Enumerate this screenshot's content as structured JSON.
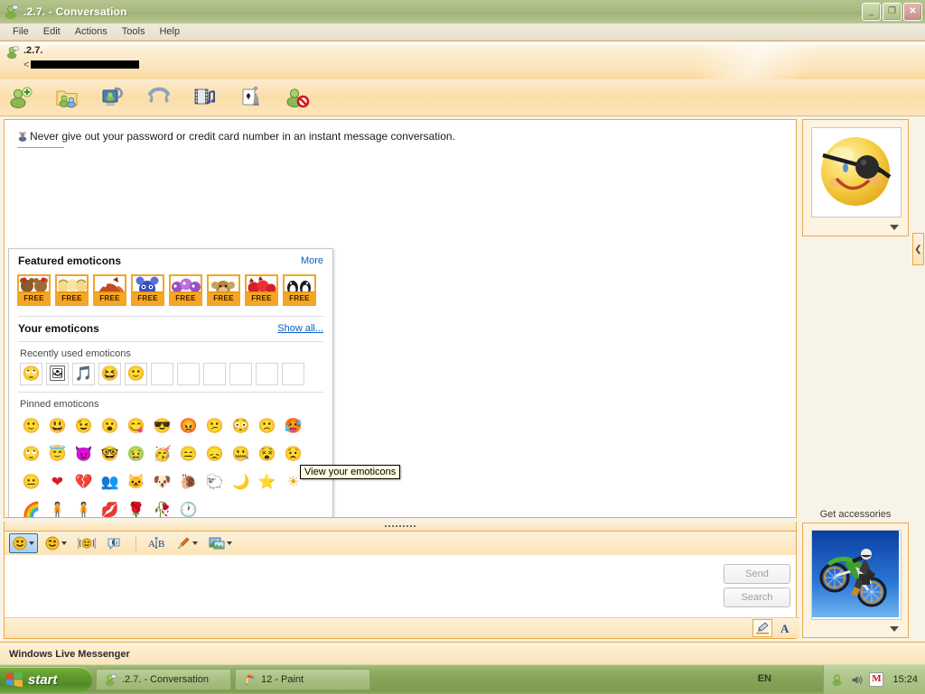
{
  "window": {
    "title": ".2.7. - Conversation",
    "icon": "messenger-contact-icon",
    "controls": {
      "minimize": "_",
      "restore": "❐",
      "close": "✕"
    }
  },
  "menubar": {
    "items": [
      {
        "label": "File"
      },
      {
        "label": "Edit"
      },
      {
        "label": "Actions"
      },
      {
        "label": "Tools"
      },
      {
        "label": "Help"
      }
    ]
  },
  "contact_header": {
    "display_name": ".2.7.",
    "email_prefix": "<",
    "email_redacted": true
  },
  "action_toolbar": {
    "buttons": [
      {
        "name": "invite-someone",
        "icon": "person-plus-icon"
      },
      {
        "name": "share-files",
        "icon": "folder-share-icon"
      },
      {
        "name": "video-call",
        "icon": "webcam-icon"
      },
      {
        "name": "voice-call",
        "icon": "phone-icon"
      },
      {
        "name": "share-media",
        "icon": "filmstrip-music-icon"
      },
      {
        "name": "play-game",
        "icon": "cards-chess-icon"
      },
      {
        "name": "block-contact",
        "icon": "person-block-icon"
      }
    ]
  },
  "conversation": {
    "safety_warning": "Never give out your password or credit card number in an instant message conversation."
  },
  "emoticon_panel": {
    "featured": {
      "title": "Featured emoticons",
      "more_label": "More",
      "packs": [
        {
          "label": "FREE",
          "art": "bears-pack"
        },
        {
          "label": "FREE",
          "art": "kids-pack"
        },
        {
          "label": "FREE",
          "art": "fox-pack"
        },
        {
          "label": "FREE",
          "art": "blue-monster-pack"
        },
        {
          "label": "FREE",
          "art": "purple-friends-pack"
        },
        {
          "label": "FREE",
          "art": "monkey-pack"
        },
        {
          "label": "FREE",
          "art": "red-devils-pack"
        },
        {
          "label": "FREE",
          "art": "penguins-pack"
        }
      ]
    },
    "your_emoticons": {
      "title": "Your emoticons",
      "show_all_label": "Show all..."
    },
    "recently_used": {
      "label": "Recently used emoticons",
      "items": [
        {
          "glyph": "🙄",
          "name": "eye-roll-emoticon"
        },
        {
          "glyph": "🖼",
          "name": "custom-photo-emoticon"
        },
        {
          "glyph": "🎵",
          "name": "music-note-emoticon"
        },
        {
          "glyph": "😆",
          "name": "grin-emoticon"
        },
        {
          "glyph": "🙂",
          "name": "smile-emoticon"
        }
      ],
      "empty_slots": 6
    },
    "pinned": {
      "label": "Pinned emoticons",
      "rows": [
        [
          {
            "glyph": "🙂",
            "name": "smile-emoticon"
          },
          {
            "glyph": "😃",
            "name": "open-mouth-smile-emoticon"
          },
          {
            "glyph": "😉",
            "name": "wink-emoticon"
          },
          {
            "glyph": "😮",
            "name": "surprised-emoticon"
          },
          {
            "glyph": "😋",
            "name": "tongue-out-emoticon"
          },
          {
            "glyph": "😎",
            "name": "sunglasses-emoticon"
          },
          {
            "glyph": "😡",
            "name": "angry-emoticon"
          },
          {
            "glyph": "😕",
            "name": "confused-emoticon"
          },
          {
            "glyph": "😳",
            "name": "embarrassed-emoticon"
          },
          {
            "glyph": "🙁",
            "name": "sad-emoticon"
          },
          {
            "glyph": "🥵",
            "name": "hot-emoticon"
          }
        ],
        [
          {
            "glyph": "🙄",
            "name": "eye-roll-emoticon"
          },
          {
            "glyph": "😇",
            "name": "angel-emoticon"
          },
          {
            "glyph": "😈",
            "name": "devil-emoticon"
          },
          {
            "glyph": "🤓",
            "name": "nerd-emoticon"
          },
          {
            "glyph": "🤢",
            "name": "sick-emoticon"
          },
          {
            "glyph": "🥳",
            "name": "party-emoticon"
          },
          {
            "glyph": "😑",
            "name": "sarcastic-emoticon"
          },
          {
            "glyph": "😞",
            "name": "disappointed-emoticon"
          },
          {
            "glyph": "🤐",
            "name": "sealed-lips-emoticon"
          },
          {
            "glyph": "😵",
            "name": "eyes-emoticon"
          },
          {
            "glyph": "😟",
            "name": "worried-emoticon"
          }
        ],
        [
          {
            "glyph": "😐",
            "name": "neutral-face-emoticon"
          },
          {
            "glyph": "❤",
            "name": "heart-emoticon"
          },
          {
            "glyph": "💔",
            "name": "broken-heart-emoticon"
          },
          {
            "glyph": "👥",
            "name": "messenger-buddies-emoticon"
          },
          {
            "glyph": "🐱",
            "name": "cat-emoticon"
          },
          {
            "glyph": "🐶",
            "name": "dog-emoticon"
          },
          {
            "glyph": "🐌",
            "name": "snail-emoticon"
          },
          {
            "glyph": "🐑",
            "name": "sheep-emoticon"
          },
          {
            "glyph": "🌙",
            "name": "moon-emoticon"
          },
          {
            "glyph": "⭐",
            "name": "star-emoticon"
          },
          {
            "glyph": "☀",
            "name": "sun-emoticon"
          }
        ],
        [
          {
            "glyph": "🌈",
            "name": "rainbow-emoticon"
          },
          {
            "glyph": "🧍",
            "name": "boy-emoticon"
          },
          {
            "glyph": "🧍",
            "name": "girl-emoticon"
          },
          {
            "glyph": "💋",
            "name": "kiss-emoticon"
          },
          {
            "glyph": "🌹",
            "name": "rose-emoticon"
          },
          {
            "glyph": "🥀",
            "name": "wilted-rose-emoticon"
          },
          {
            "glyph": "🕐",
            "name": "clock-emoticon"
          }
        ]
      ]
    },
    "tooltip": "View your emoticons"
  },
  "format_bar": {
    "buttons": [
      {
        "name": "emoticon-picker",
        "icon": "smiley-icon",
        "has_caret": true,
        "active": true
      },
      {
        "name": "winks-picker",
        "icon": "wink-icon",
        "has_caret": true,
        "active": false
      },
      {
        "name": "nudge-button",
        "icon": "nudge-icon",
        "has_caret": false,
        "active": false
      },
      {
        "name": "voice-clip-button",
        "icon": "voice-clip-icon",
        "has_caret": false,
        "active": false
      },
      {
        "name": "font-button",
        "icon": "font-ab-icon",
        "has_caret": false,
        "active": false
      },
      {
        "name": "color-button",
        "icon": "paintbrush-icon",
        "has_caret": true,
        "active": false
      },
      {
        "name": "background-button",
        "icon": "background-image-icon",
        "has_caret": true,
        "active": false
      }
    ]
  },
  "compose": {
    "input_value": "",
    "send_label": "Send",
    "search_label": "Search",
    "send_enabled": false,
    "search_enabled": false,
    "mode_buttons": [
      {
        "name": "handwriting-mode",
        "icon": "pen-icon",
        "selected": true
      },
      {
        "name": "text-mode",
        "icon": "letter-a-icon",
        "selected": false
      }
    ]
  },
  "right_panel": {
    "my_display_picture": "pirate-smiley-eyepatch",
    "accessories_label": "Get accessories",
    "contact_display_picture": "motocross-bike",
    "collapse_icon": "chevron-left-icon"
  },
  "statusbar": {
    "text": "Windows Live Messenger"
  },
  "taskbar": {
    "start_label": "start",
    "items": [
      {
        "label": ".2.7. - Conversation",
        "icon": "messenger-icon",
        "active": true
      },
      {
        "label": "12 - Paint",
        "icon": "paint-icon",
        "active": false
      }
    ],
    "tray": {
      "language": "EN",
      "icons": [
        {
          "name": "messenger-tray-icon"
        },
        {
          "name": "volume-tray-icon"
        },
        {
          "name": "mcafee-tray-icon",
          "label": "M"
        }
      ],
      "clock": "15:24"
    }
  },
  "colors": {
    "accent_orange": "#e9a948",
    "title_green": "#a8ba7e",
    "link_blue": "#0a5fc0",
    "panel_cream": "#fdf3e0"
  }
}
